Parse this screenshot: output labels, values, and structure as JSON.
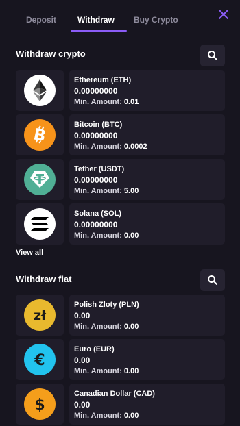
{
  "tabs": [
    {
      "label": "Deposit",
      "active": false
    },
    {
      "label": "Withdraw",
      "active": true
    },
    {
      "label": "Buy Crypto",
      "active": false
    }
  ],
  "accent_color": "#8b5cf6",
  "crypto_section": {
    "title": "Withdraw crypto",
    "view_all": "View all",
    "items": [
      {
        "name": "Ethereum (ETH)",
        "balance": "0.00000000",
        "min_label": "Min. Amount:",
        "min_value": "0.01",
        "icon": "ethereum-icon",
        "color": "#ffffff"
      },
      {
        "name": "Bitcoin (BTC)",
        "balance": "0.00000000",
        "min_label": "Min. Amount:",
        "min_value": "0.0002",
        "icon": "bitcoin-icon",
        "color": "#f7931a"
      },
      {
        "name": "Tether (USDT)",
        "balance": "0.00000000",
        "min_label": "Min. Amount:",
        "min_value": "5.00",
        "icon": "tether-icon",
        "color": "#50af95"
      },
      {
        "name": "Solana (SOL)",
        "balance": "0.00000000",
        "min_label": "Min. Amount:",
        "min_value": "0.00",
        "icon": "solana-icon",
        "color": "#ffffff"
      }
    ]
  },
  "fiat_section": {
    "title": "Withdraw fiat",
    "items": [
      {
        "name": "Polish Zloty (PLN)",
        "balance": "0.00",
        "min_label": "Min. Amount:",
        "min_value": "0.00",
        "icon": "zloty-icon",
        "symbol": "zł",
        "color": "#e8b92e"
      },
      {
        "name": "Euro (EUR)",
        "balance": "0.00",
        "min_label": "Min. Amount:",
        "min_value": "0.00",
        "icon": "euro-icon",
        "symbol": "€",
        "color": "#22c3ee"
      },
      {
        "name": "Canadian Dollar (CAD)",
        "balance": "0.00",
        "min_label": "Min. Amount:",
        "min_value": "0.00",
        "icon": "dollar-icon",
        "symbol": "$",
        "color": "#f59e1b"
      }
    ]
  }
}
